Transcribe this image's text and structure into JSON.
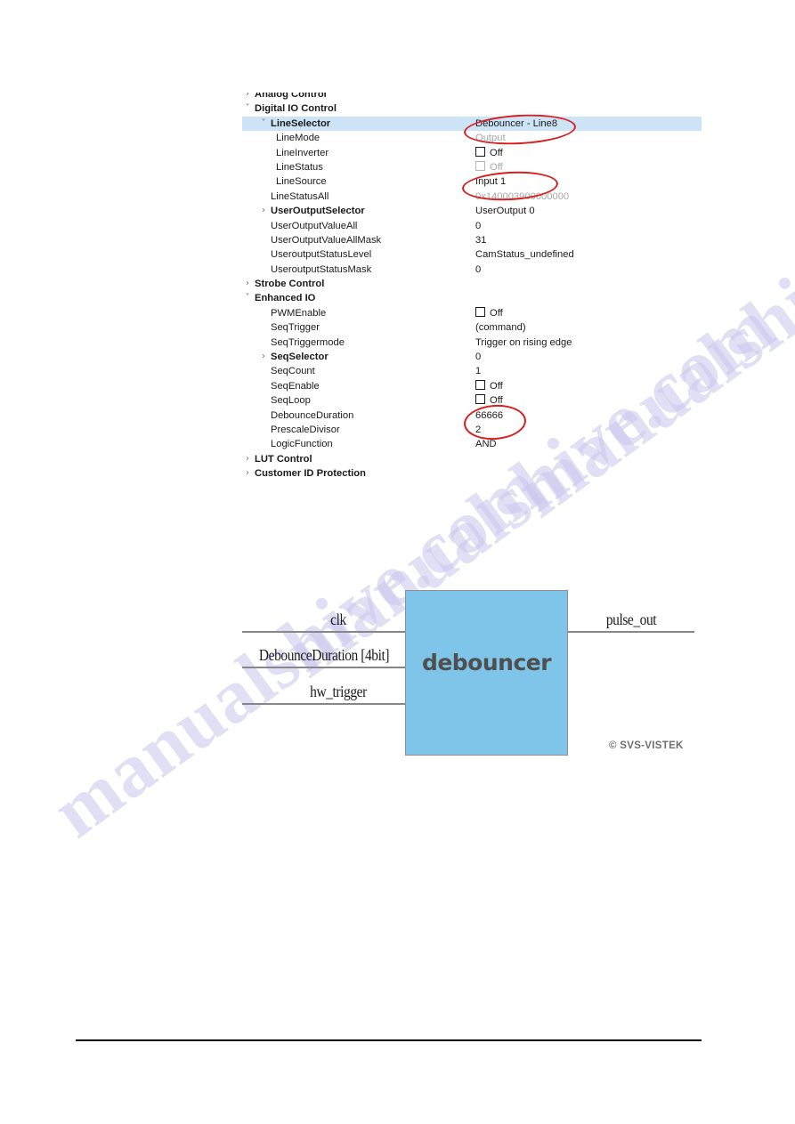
{
  "tree": {
    "rows": [
      {
        "level": 0,
        "arrow": "›",
        "label": "Analog Control",
        "bold": true,
        "value": "",
        "value_kind": "text",
        "clipped_top": true
      },
      {
        "level": 0,
        "arrow": "˅",
        "label": "Digital IO Control",
        "bold": true,
        "value": "",
        "value_kind": "text"
      },
      {
        "level": 1,
        "arrow": "˅",
        "label": "LineSelector",
        "bold": true,
        "value": "Debouncer - Line8",
        "value_kind": "text",
        "selected": true
      },
      {
        "level": 2,
        "arrow": "",
        "label": "LineMode",
        "bold": false,
        "value": "Output",
        "value_kind": "dim"
      },
      {
        "level": 2,
        "arrow": "",
        "label": "LineInverter",
        "bold": false,
        "value": "Off",
        "value_kind": "checkbox"
      },
      {
        "level": 2,
        "arrow": "",
        "label": "LineStatus",
        "bold": false,
        "value": "Off",
        "value_kind": "checkbox-dim"
      },
      {
        "level": 2,
        "arrow": "",
        "label": "LineSource",
        "bold": false,
        "value": "Input 1",
        "value_kind": "text"
      },
      {
        "level": 1,
        "arrow": "",
        "label": "LineStatusAll",
        "bold": false,
        "value": "0x140003900000000",
        "value_kind": "dim"
      },
      {
        "level": 1,
        "arrow": "›",
        "label": "UserOutputSelector",
        "bold": true,
        "value": "UserOutput 0",
        "value_kind": "text"
      },
      {
        "level": 1,
        "arrow": "",
        "label": "UserOutputValueAll",
        "bold": false,
        "value": "0",
        "value_kind": "text"
      },
      {
        "level": 1,
        "arrow": "",
        "label": "UserOutputValueAllMask",
        "bold": false,
        "value": "31",
        "value_kind": "text"
      },
      {
        "level": 1,
        "arrow": "",
        "label": "UseroutputStatusLevel",
        "bold": false,
        "value": "CamStatus_undefined",
        "value_kind": "text"
      },
      {
        "level": 1,
        "arrow": "",
        "label": "UseroutputStatusMask",
        "bold": false,
        "value": "0",
        "value_kind": "text"
      },
      {
        "level": 0,
        "arrow": "›",
        "label": "Strobe Control",
        "bold": true,
        "value": "",
        "value_kind": "text"
      },
      {
        "level": 0,
        "arrow": "˅",
        "label": "Enhanced IO",
        "bold": true,
        "value": "",
        "value_kind": "text"
      },
      {
        "level": 1,
        "arrow": "",
        "label": "PWMEnable",
        "bold": false,
        "value": "Off",
        "value_kind": "checkbox"
      },
      {
        "level": 1,
        "arrow": "",
        "label": "SeqTrigger",
        "bold": false,
        "value": "(command)",
        "value_kind": "text"
      },
      {
        "level": 1,
        "arrow": "",
        "label": "SeqTriggermode",
        "bold": false,
        "value": "Trigger on rising edge",
        "value_kind": "text"
      },
      {
        "level": 1,
        "arrow": "›",
        "label": "SeqSelector",
        "bold": true,
        "value": "0",
        "value_kind": "text"
      },
      {
        "level": 1,
        "arrow": "",
        "label": "SeqCount",
        "bold": false,
        "value": "1",
        "value_kind": "text"
      },
      {
        "level": 1,
        "arrow": "",
        "label": "SeqEnable",
        "bold": false,
        "value": "Off",
        "value_kind": "checkbox"
      },
      {
        "level": 1,
        "arrow": "",
        "label": "SeqLoop",
        "bold": false,
        "value": "Off",
        "value_kind": "checkbox"
      },
      {
        "level": 1,
        "arrow": "",
        "label": "DebounceDuration",
        "bold": false,
        "value": "66666",
        "value_kind": "text"
      },
      {
        "level": 1,
        "arrow": "",
        "label": "PrescaleDivisor",
        "bold": false,
        "value": "2",
        "value_kind": "text"
      },
      {
        "level": 1,
        "arrow": "",
        "label": "LogicFunction",
        "bold": false,
        "value": "AND",
        "value_kind": "text"
      },
      {
        "level": 0,
        "arrow": "›",
        "label": "LUT Control",
        "bold": true,
        "value": "",
        "value_kind": "text"
      },
      {
        "level": 0,
        "arrow": "›",
        "label": "Customer ID Protection",
        "bold": true,
        "value": "",
        "value_kind": "text",
        "clipped_bottom": true
      }
    ]
  },
  "annotations": {
    "color": "#d81f20",
    "ellipses": [
      {
        "target": "LineSelector value",
        "text": "Debouncer - Line8"
      },
      {
        "target": "LineSource value",
        "text": "Input 1"
      },
      {
        "target": "DebounceDuration value",
        "text": "66666"
      }
    ]
  },
  "diagram": {
    "block_label": "debouncer",
    "block_color": "#7fc5e9",
    "inputs": [
      {
        "name": "clk"
      },
      {
        "name": "DebounceDuration [4bit]"
      },
      {
        "name": "hw_trigger"
      }
    ],
    "outputs": [
      {
        "name": "pulse_out"
      }
    ],
    "copyright": "© SVS-VISTEK"
  },
  "watermark": {
    "text": "manualshive.com",
    "color": "#c9c6ec"
  }
}
